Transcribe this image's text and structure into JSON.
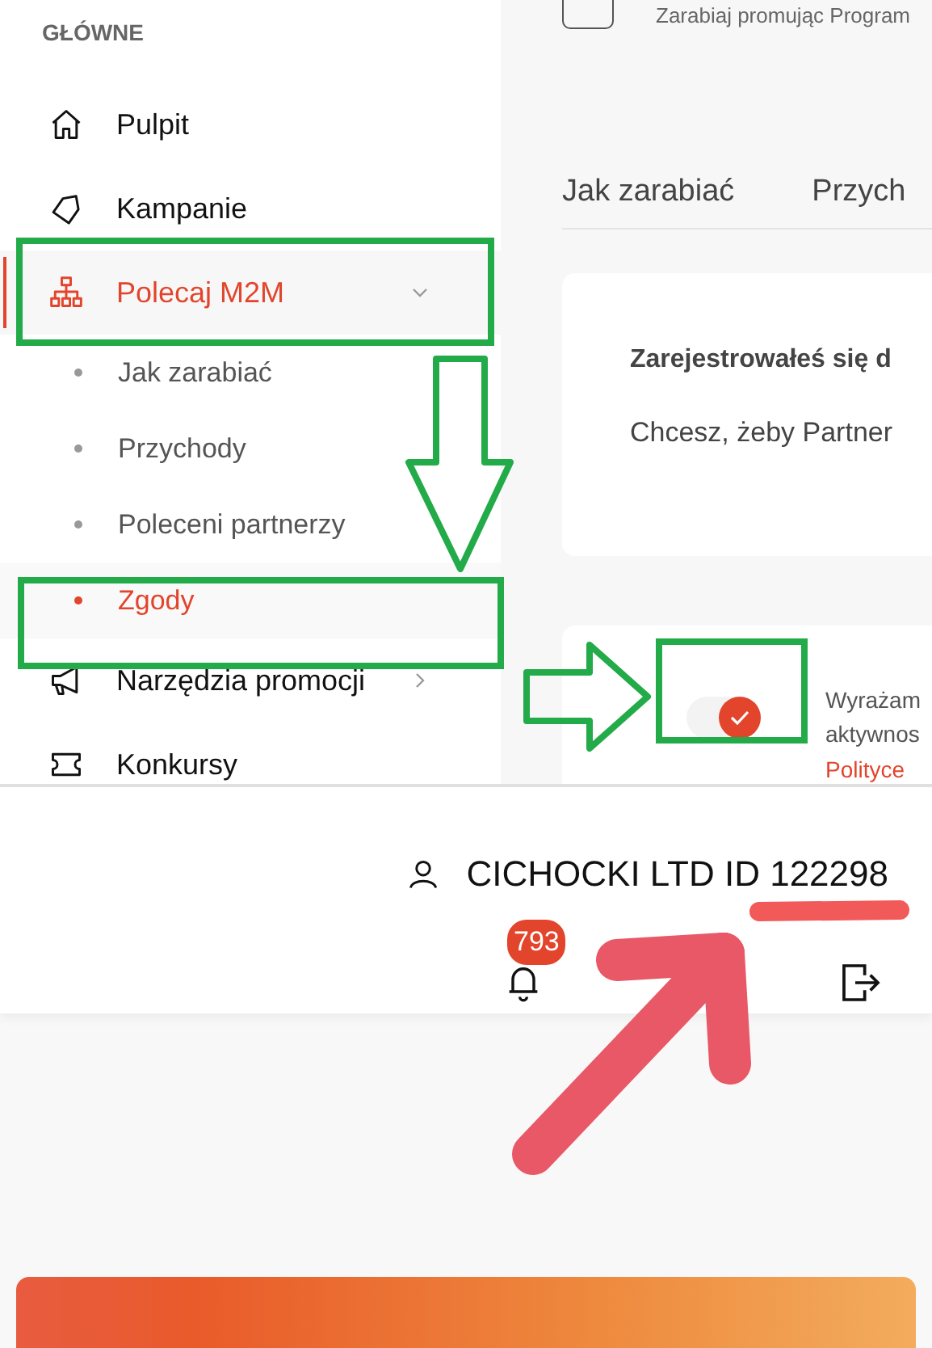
{
  "sidebar": {
    "section_label": "GŁÓWNE",
    "items": [
      {
        "label": "Pulpit",
        "selected": false
      },
      {
        "label": "Kampanie",
        "selected": false
      },
      {
        "label": "Polecaj M2M",
        "selected": true,
        "expanded": true,
        "children": [
          {
            "label": "Jak zarabiać",
            "selected": false
          },
          {
            "label": "Przychody",
            "selected": false
          },
          {
            "label": "Poleceni partnerzy",
            "selected": false
          },
          {
            "label": "Zgody",
            "selected": true
          }
        ]
      },
      {
        "label": "Narzędzia promocji",
        "selected": false,
        "expanded": false
      },
      {
        "label": "Konkursy",
        "selected": false
      }
    ]
  },
  "content": {
    "program_text": "Zarabiaj promując Program",
    "tabs": [
      {
        "label": "Jak zarabiać",
        "selected": false
      },
      {
        "label": "Przych",
        "selected": false
      }
    ],
    "info_card": {
      "title": "Zarejestrowałeś się d",
      "text": "Chcesz, żeby Partner"
    },
    "consent": {
      "on": true,
      "lines": [
        "Wyrażam",
        "aktywnos"
      ],
      "link": "Polityce"
    }
  },
  "header": {
    "account": "CICHOCKI LTD ID 122298",
    "notifications": "793"
  }
}
